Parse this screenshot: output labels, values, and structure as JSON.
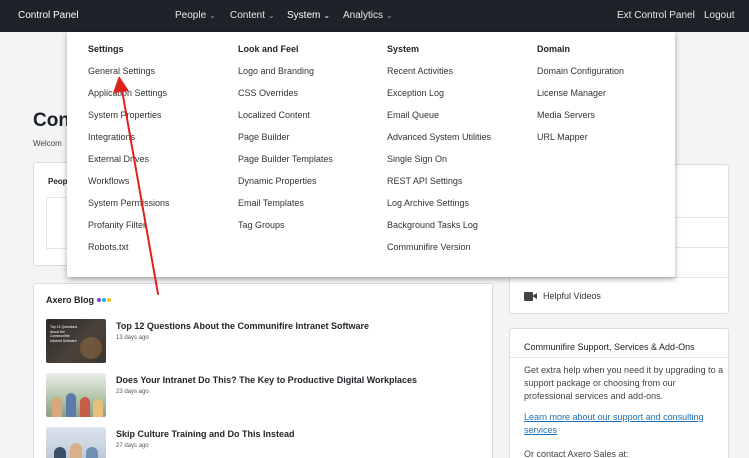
{
  "topbar": {
    "brand": "Control Panel",
    "nav": [
      {
        "label": "People"
      },
      {
        "label": "Content"
      },
      {
        "label": "System"
      },
      {
        "label": "Analytics"
      }
    ],
    "caret": "⌄",
    "ext": "Ext Control Panel",
    "logout": "Logout"
  },
  "page": {
    "title_visible": "Con",
    "welcome_visible": "Welcom",
    "people_title_visible": "Peop"
  },
  "dropdown": {
    "columns": [
      {
        "heading": "Settings",
        "items": [
          "General Settings",
          "Application Settings",
          "System Properties",
          "Integrations",
          "External Drives",
          "Workflows",
          "System Permissions",
          "Profanity Filter",
          "Robots.txt"
        ]
      },
      {
        "heading": "Look and Feel",
        "items": [
          "Logo and Branding",
          "CSS Overrides",
          "Localized Content",
          "Page Builder",
          "Page Builder Templates",
          "Dynamic Properties",
          "Email Templates",
          "Tag Groups"
        ]
      },
      {
        "heading": "System",
        "items": [
          "Recent Activities",
          "Exception Log",
          "Email Queue",
          "Advanced System Utilities",
          "Single Sign On",
          "REST API Settings",
          "Log Archive Settings",
          "Background Tasks Log",
          "Communifire Version"
        ]
      },
      {
        "heading": "Domain",
        "items": [
          "Domain Configuration",
          "License Manager",
          "Media Servers",
          "URL Mapper"
        ]
      }
    ]
  },
  "sidebar": {
    "helpful_videos": "Helpful Videos",
    "support_title": "Communifire Support, Services & Add-Ons",
    "support_body": "Get extra help when you need it by upgrading to a support package or choosing from our professional services and add-ons.",
    "support_link": "Learn more about our support and consulting services",
    "contact": "Or contact Axero Sales at:"
  },
  "blog": {
    "title": "Axero Blog",
    "dot_colors": [
      "#7b3fe4",
      "#1fb6e9",
      "#f7c325"
    ],
    "posts": [
      {
        "title": "Top 12 Questions About the Communifire Intranet Software",
        "date": "13 days ago",
        "thumb_text": "Top 12 Questions About the Communifire Intranet Software"
      },
      {
        "title": "Does Your Intranet Do This? The Key to Productive Digital Workplaces",
        "date": "23 days ago"
      },
      {
        "title": "Skip Culture Training and Do This Instead",
        "date": "27 days ago"
      }
    ]
  },
  "colors": {
    "topbar": "#1f2228",
    "arrow": "#e0201c",
    "link": "#1f6fb2"
  }
}
